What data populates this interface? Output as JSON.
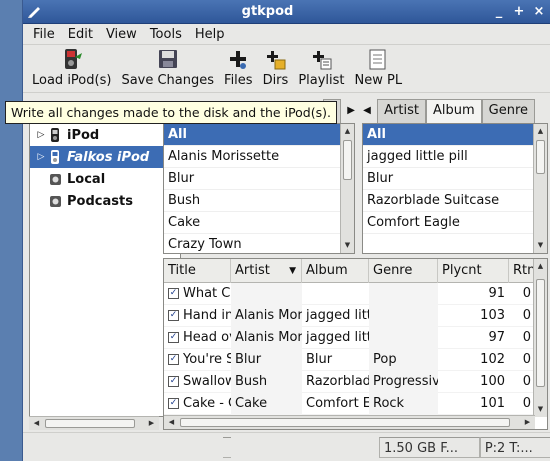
{
  "window": {
    "title": "gtkpod"
  },
  "menu": [
    "File",
    "Edit",
    "View",
    "Tools",
    "Help"
  ],
  "toolbar": [
    {
      "label": "Load iPod(s)",
      "icon": "load-ipod-icon"
    },
    {
      "label": "Save Changes",
      "icon": "save-icon"
    },
    {
      "label": "Files",
      "icon": "add-files-icon"
    },
    {
      "label": "Dirs",
      "icon": "add-dirs-icon"
    },
    {
      "label": "Playlist",
      "icon": "add-playlist-icon"
    },
    {
      "label": "New PL",
      "icon": "new-playlist-icon"
    }
  ],
  "tooltip": "Write all changes made to the disk and the iPod(s).",
  "tabs": {
    "partial": "",
    "left": [
      "Artist",
      "Album",
      "Genre"
    ],
    "active": "Album"
  },
  "tree": [
    {
      "label": "iPod",
      "selected": false,
      "expander": "▷",
      "icon": "ipod-icon"
    },
    {
      "label": "Falkos iPod",
      "selected": true,
      "expander": "▷",
      "icon": "ipod-icon"
    },
    {
      "label": "Local",
      "selected": false,
      "expander": "",
      "icon": "local-icon"
    },
    {
      "label": "Podcasts",
      "selected": false,
      "expander": "",
      "icon": "podcast-icon"
    }
  ],
  "artists": [
    "All",
    "Alanis Morissette",
    "Blur",
    "Bush",
    "Cake",
    "Crazy Town"
  ],
  "albums": [
    "All",
    "jagged little pill",
    "Blur",
    "Razorblade Suitcase",
    "Comfort Eagle"
  ],
  "tracks": {
    "headers": [
      "Title",
      "Artist",
      "Album",
      "Genre",
      "Plycnt",
      "Rtng"
    ],
    "sort_indicator": "▼",
    "rows": [
      {
        "title": "What Co",
        "artist": "",
        "album": "",
        "genre": "",
        "plycnt": "91",
        "rtng": "0"
      },
      {
        "title": "Hand in",
        "artist": "Alanis Mor",
        "album": "jagged littl",
        "genre": "",
        "plycnt": "103",
        "rtng": "0"
      },
      {
        "title": "Head ov",
        "artist": "Alanis Mor",
        "album": "jagged littl",
        "genre": "",
        "plycnt": "97",
        "rtng": "0"
      },
      {
        "title": "You're S",
        "artist": "Blur",
        "album": "Blur",
        "genre": "Pop",
        "plycnt": "102",
        "rtng": "0"
      },
      {
        "title": "Swallow",
        "artist": "Bush",
        "album": "Razorblade",
        "genre": "Progressiv",
        "plycnt": "100",
        "rtng": "0"
      },
      {
        "title": "Cake - C",
        "artist": "Cake",
        "album": "Comfort E",
        "genre": "Rock",
        "plycnt": "101",
        "rtng": "0"
      }
    ]
  },
  "status": {
    "space": "1.50 GB F...",
    "info": "P:2 T:..."
  }
}
